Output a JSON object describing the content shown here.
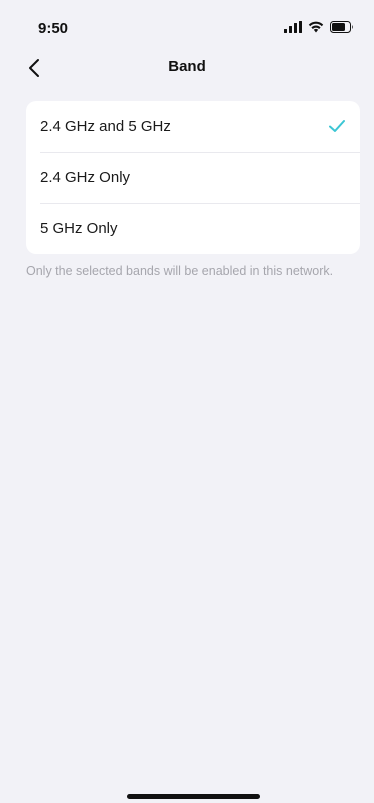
{
  "status_bar": {
    "time": "9:50",
    "icons": [
      "signal-icon",
      "wifi-icon",
      "battery-icon"
    ]
  },
  "nav": {
    "back_icon": "chevron-left-icon",
    "title": "Band"
  },
  "band_options": [
    {
      "label": "2.4 GHz and 5 GHz",
      "selected": true
    },
    {
      "label": "2.4 GHz Only",
      "selected": false
    },
    {
      "label": "5 GHz Only",
      "selected": false
    }
  ],
  "footnote": "Only the selected bands will be enabled in this network.",
  "colors": {
    "accent_check": "#3cc6d4",
    "background": "#f2f2f7",
    "card": "#ffffff"
  }
}
